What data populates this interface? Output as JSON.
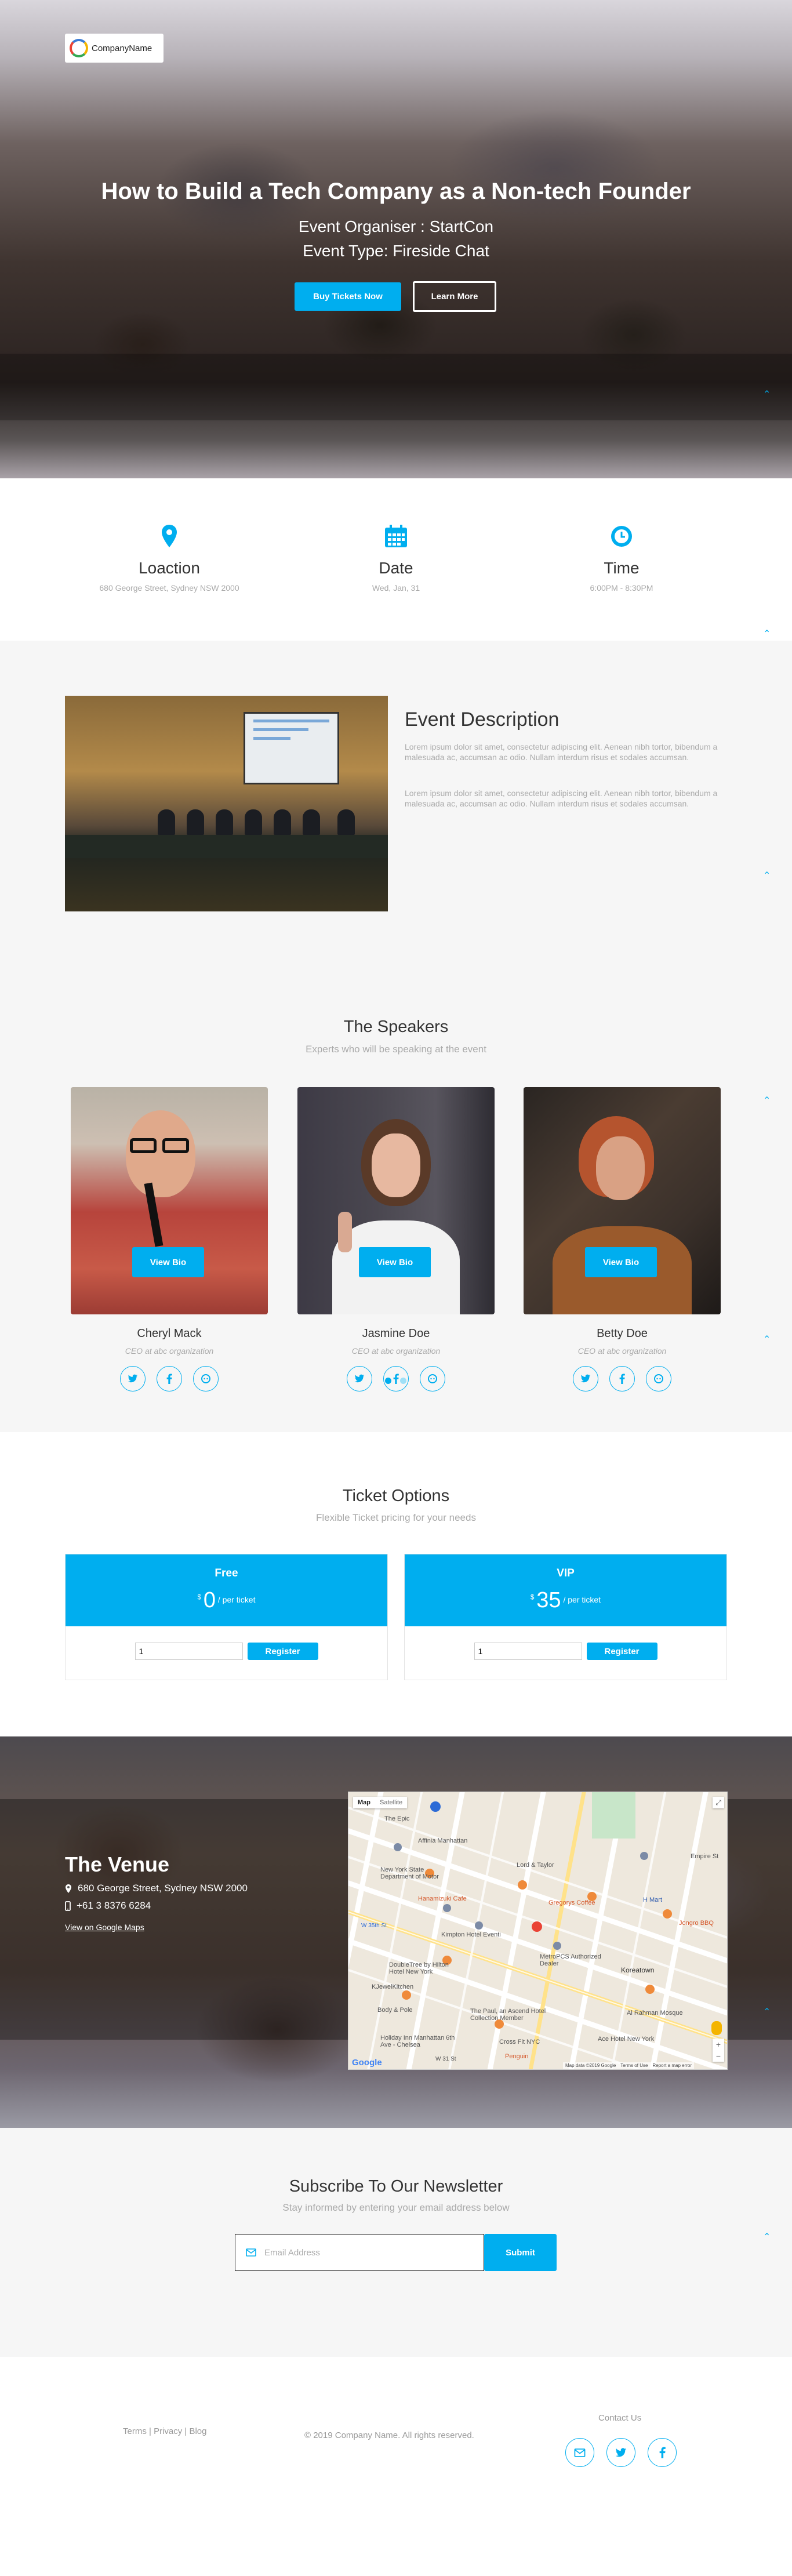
{
  "brand": {
    "name": "CompanyName"
  },
  "hero": {
    "title": "How to Build a Tech Company as a Non-tech Founder",
    "organiser": "Event Organiser : StartCon",
    "event_type": "Event Type: Fireside Chat",
    "buy_label": "Buy Tickets Now",
    "learn_label": "Learn More"
  },
  "info": [
    {
      "icon": "map-pin-icon",
      "title": "Loaction",
      "value": "680 George Street, Sydney NSW 2000"
    },
    {
      "icon": "calendar-icon",
      "title": "Date",
      "value": "Wed, Jan, 31"
    },
    {
      "icon": "clock-icon",
      "title": "Time",
      "value": "6:00PM - 8:30PM"
    }
  ],
  "description": {
    "title": "Event Description",
    "p1": "Lorem ipsum dolor sit amet, consectetur adipiscing elit. Aenean nibh tortor, bibendum a malesuada ac, accumsan ac odio. Nullam interdum risus et sodales accumsan.",
    "p2": "Lorem ipsum dolor sit amet, consectetur adipiscing elit. Aenean nibh tortor, bibendum a malesuada ac, accumsan ac odio. Nullam interdum risus et sodales accumsan."
  },
  "speakers": {
    "title": "The Speakers",
    "subtitle": "Experts who will be speaking at the event",
    "bio_label": "View Bio",
    "items": [
      {
        "name": "Cheryl Mack",
        "role": "CEO at abc organization"
      },
      {
        "name": "Jasmine Doe",
        "role": "CEO at abc organization"
      },
      {
        "name": "Betty Doe",
        "role": "CEO at abc organization"
      }
    ],
    "social_icons": [
      "twitter-icon",
      "facebook-icon",
      "github-icon"
    ]
  },
  "tickets": {
    "title": "Ticket Options",
    "subtitle": "Flexible Ticket pricing for your needs",
    "register_label": "Register",
    "items": [
      {
        "name": "Free",
        "currency": "$",
        "price": "0",
        "unit": "/ per ticket",
        "qty": "1"
      },
      {
        "name": "VIP",
        "currency": "$",
        "price": "35",
        "unit": "/ per ticket",
        "qty": "1"
      }
    ]
  },
  "venue": {
    "title": "The Venue",
    "address": "680 George Street, Sydney NSW 2000",
    "phone": "+61 3 8376 6284",
    "map_link": "View on Google Maps",
    "map": {
      "tabs": [
        "Map",
        "Satellite"
      ],
      "labels": [
        "The Epic",
        "Affinia Manhattan",
        "New York State Department of Motor",
        "Hanamizuki Cafe",
        "Lord & Taylor",
        "Gregorys Coffee",
        "H Mart",
        "Empire St",
        "Jongro BBQ",
        "Kimpton Hotel Eventi",
        "W 35th St",
        "DoubleTree by Hilton Hotel New York",
        "MetroPCS Authorized Dealer",
        "Koreatown",
        "KJewelKitchen",
        "Body & Pole",
        "The Paul, an Ascend Hotel Collection Member",
        "Ace Hotel New York",
        "Al Rahman Mosque",
        "Holiday Inn Manhattan 6th Ave - Chelsea",
        "Cross Fit NYC",
        "Penguin",
        "W 31 St",
        "Google"
      ],
      "attribution": "Map data ©2019 Google",
      "terms": "Terms of Use",
      "report": "Report a map error"
    }
  },
  "newsletter": {
    "title": "Subscribe To Our Newsletter",
    "subtitle": "Stay informed by entering your email address below",
    "placeholder": "Email Address",
    "submit_label": "Submit"
  },
  "footer": {
    "links": "Terms | Privacy | Blog",
    "copyright": "© 2019 Company Name. All rights reserved.",
    "contact_title": "Contact Us",
    "contact_icons": [
      "mail-icon",
      "twitter-icon",
      "facebook-icon"
    ]
  },
  "colors": {
    "accent": "#00aeef",
    "text": "#333333",
    "muted": "#aaaaaa",
    "section_bg": "#f6f6f6"
  }
}
